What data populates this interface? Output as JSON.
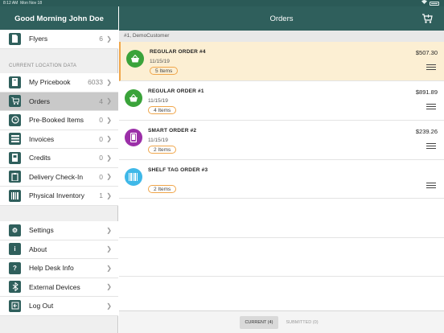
{
  "status_bar": {
    "time": "8:12 AM",
    "date": "Mon Nov 18",
    "battery_icon": "battery-icon",
    "wifi_icon": "wifi-icon"
  },
  "sidebar": {
    "greeting": "Good Morning John Doe",
    "top_items": [
      {
        "label": "Flyers",
        "count": "6",
        "icon": "document-icon"
      }
    ],
    "section_title": "CURRENT LOCATION DATA",
    "location_items": [
      {
        "label": "My Pricebook",
        "count": "6033",
        "icon": "book-icon"
      },
      {
        "label": "Orders",
        "count": "4",
        "icon": "cart-icon"
      },
      {
        "label": "Pre-Booked Items",
        "count": "0",
        "icon": "alarm-clock-icon"
      },
      {
        "label": "Invoices",
        "count": "0",
        "icon": "list-icon"
      },
      {
        "label": "Credits",
        "count": "0",
        "icon": "credit-icon"
      },
      {
        "label": "Delivery Check-In",
        "count": "0",
        "icon": "clipboard-icon"
      },
      {
        "label": "Physical Inventory",
        "count": "1",
        "icon": "barcode-icon"
      }
    ],
    "bottom_items": [
      {
        "label": "Settings",
        "icon": "gear-icon"
      },
      {
        "label": "About",
        "icon": "info-icon"
      },
      {
        "label": "Help Desk Info",
        "icon": "question-icon"
      },
      {
        "label": "External Devices",
        "icon": "bluetooth-icon"
      },
      {
        "label": "Log Out",
        "icon": "logout-icon"
      }
    ]
  },
  "main": {
    "title": "Orders",
    "customer": "#1, DemoCustomer",
    "orders": [
      {
        "title": "REGULAR ORDER #4",
        "date": "11/15/19",
        "items": "5 Items",
        "amount": "$507.30",
        "icon": "basket-icon",
        "color": "#3aa33a"
      },
      {
        "title": "REGULAR ORDER #1",
        "date": "11/15/19",
        "items": "4 Items",
        "amount": "$891.89",
        "icon": "basket-icon",
        "color": "#3aa33a"
      },
      {
        "title": "SMART ORDER #2",
        "date": "11/15/19",
        "items": "2 Items",
        "amount": "$239.26",
        "icon": "phone-icon",
        "color": "#9b2fa8"
      },
      {
        "title": "SHELF TAG ORDER #3",
        "date": "11/15/19",
        "items": "2 Items",
        "amount": "",
        "icon": "barcode-icon",
        "color": "#3fb8e8"
      }
    ],
    "tabs": {
      "current": "CURRENT (4)",
      "submitted": "SUBMITTED (0)"
    }
  },
  "colors": {
    "header": "#2f5f5c",
    "highlight": "#fcefd3",
    "accent": "#f0a64a"
  }
}
